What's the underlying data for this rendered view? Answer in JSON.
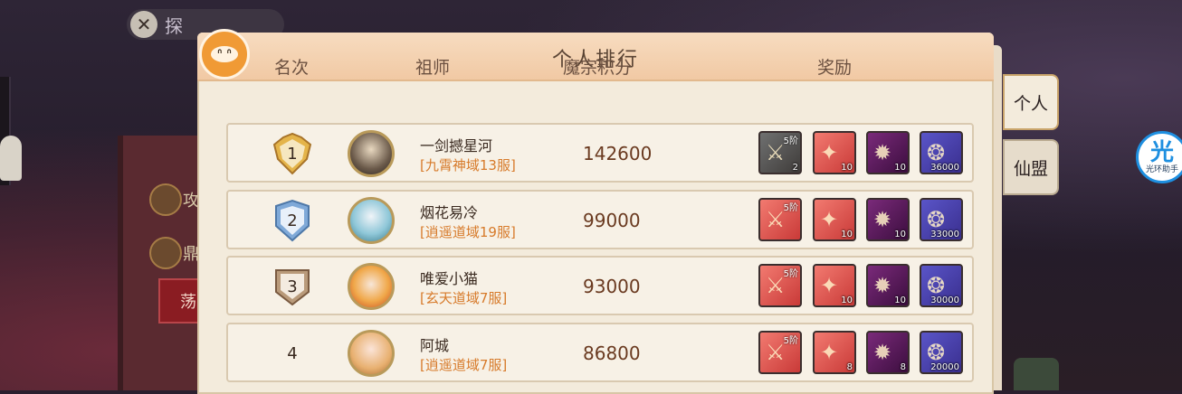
{
  "panel": {
    "title": "个人排行"
  },
  "background": {
    "search_button_label": "探",
    "side_items": [
      "攻",
      "鼎"
    ],
    "red_button_label": "荡"
  },
  "columns": {
    "rank": "名次",
    "founder": "祖师",
    "score": "魔宗积分",
    "rewards": "奖励"
  },
  "tabs": {
    "personal": "个人",
    "alliance": "仙盟"
  },
  "helper": {
    "glyph": "光",
    "label": "光环助手"
  },
  "rows": [
    {
      "rank": "1",
      "name": "一剑撼星河",
      "server": "[九霄神域13服]",
      "score": "142600",
      "rewards": [
        {
          "tier": "5阶",
          "qty": "2"
        },
        {
          "tier": "",
          "qty": "10"
        },
        {
          "tier": "",
          "qty": "10"
        },
        {
          "tier": "",
          "qty": "36000"
        }
      ]
    },
    {
      "rank": "2",
      "name": "烟花易冷",
      "server": "[逍遥道域19服]",
      "score": "99000",
      "rewards": [
        {
          "tier": "5阶",
          "qty": ""
        },
        {
          "tier": "",
          "qty": "10"
        },
        {
          "tier": "",
          "qty": "10"
        },
        {
          "tier": "",
          "qty": "33000"
        }
      ]
    },
    {
      "rank": "3",
      "name": "唯爱小猫",
      "server": "[玄天道域7服]",
      "score": "93000",
      "rewards": [
        {
          "tier": "5阶",
          "qty": ""
        },
        {
          "tier": "",
          "qty": "10"
        },
        {
          "tier": "",
          "qty": "10"
        },
        {
          "tier": "",
          "qty": "30000"
        }
      ]
    },
    {
      "rank": "4",
      "name": "阿城",
      "server": "[逍遥道域7服]",
      "score": "86800",
      "rewards": [
        {
          "tier": "5阶",
          "qty": ""
        },
        {
          "tier": "",
          "qty": "8"
        },
        {
          "tier": "",
          "qty": "8"
        },
        {
          "tier": "",
          "qty": "20000"
        }
      ]
    }
  ],
  "colors": {
    "panel_bg": "#f3ebdc",
    "header_bg": "#f1c9a4",
    "server_text": "#d77a2a",
    "score_text": "#6a3a20",
    "gold": "#d6a43a",
    "silver": "#8fb3df",
    "bronze": "#b99a7a"
  }
}
